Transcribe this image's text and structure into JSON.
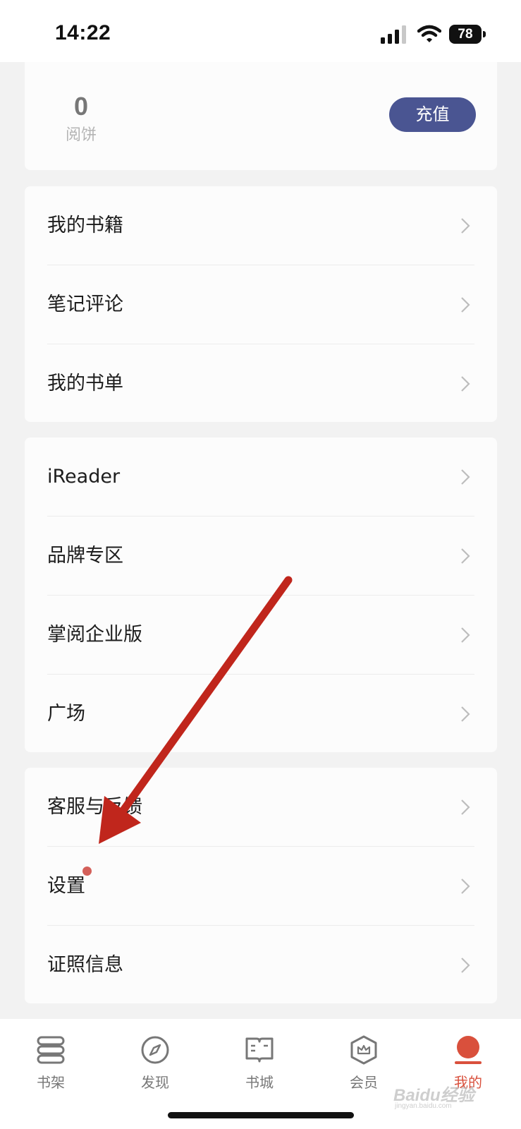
{
  "status_bar": {
    "time": "14:22",
    "battery": "78",
    "icons": [
      "signal-icon",
      "wifi-icon",
      "battery-icon"
    ]
  },
  "wallet": {
    "count": "0",
    "unit": "阅饼",
    "recharge_label": "充值",
    "recharge_color": "#4a5592"
  },
  "menu_group_1": {
    "items": [
      {
        "label": "我的书籍"
      },
      {
        "label": "笔记评论"
      },
      {
        "label": "我的书单"
      }
    ]
  },
  "menu_group_2": {
    "items": [
      {
        "label": "iReader"
      },
      {
        "label": "品牌专区"
      },
      {
        "label": "掌阅企业版"
      },
      {
        "label": "广场"
      }
    ]
  },
  "menu_group_3": {
    "items": [
      {
        "label": "客服与反馈"
      },
      {
        "label": "设置",
        "badge": "red-dot"
      },
      {
        "label": "证照信息"
      }
    ]
  },
  "tab_bar": {
    "tabs": [
      {
        "label": "书架",
        "icon": "bookshelf-icon"
      },
      {
        "label": "发现",
        "icon": "compass-icon"
      },
      {
        "label": "书城",
        "icon": "open-book-icon"
      },
      {
        "label": "会员",
        "icon": "crown-badge-icon"
      },
      {
        "label": "我的",
        "icon": "profile-dot-icon",
        "active": true
      }
    ],
    "active_color": "#d9503c",
    "inactive_color": "#777777"
  },
  "annotation": {
    "arrow_color": "#c0261c"
  },
  "watermark": {
    "text": "Baidu经验",
    "sub": "jingyan.baidu.com"
  }
}
